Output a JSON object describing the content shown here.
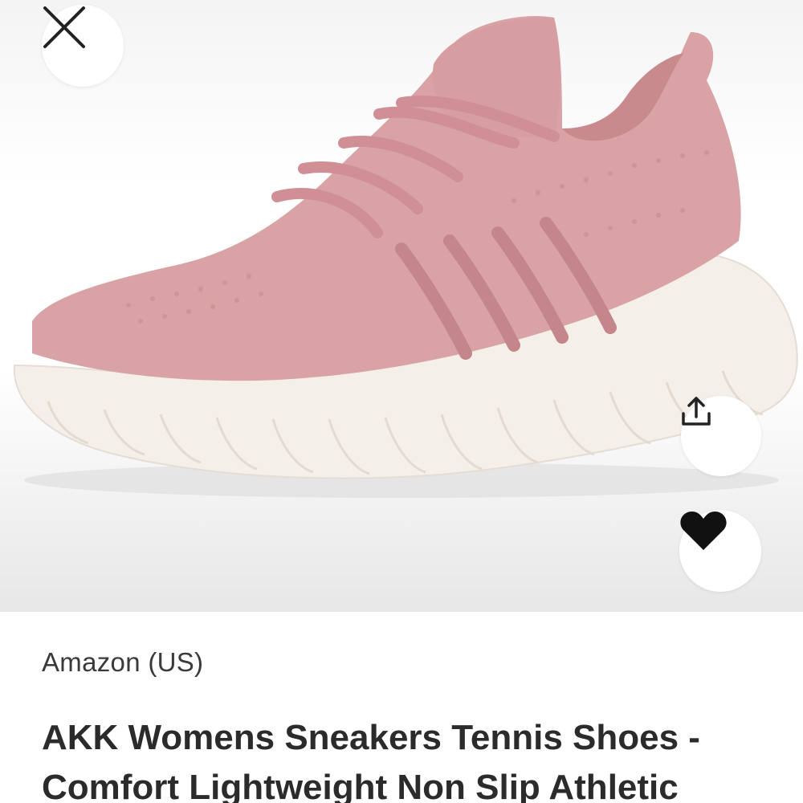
{
  "image": {
    "alt": "Pink knit slip-on sneaker with white sole",
    "shoe_upper_color": "#d9a3a5",
    "shoe_lace_color": "#cf8f94",
    "shoe_sole_color": "#f4efe9"
  },
  "buttons": {
    "close_icon": "close-icon",
    "share_icon": "share-upload-icon",
    "favorite_icon": "heart-icon"
  },
  "product": {
    "store": "Amazon (US)",
    "title": "AKK Womens Sneakers Tennis Shoes - Comfort Lightweight Non Slip Athletic"
  }
}
